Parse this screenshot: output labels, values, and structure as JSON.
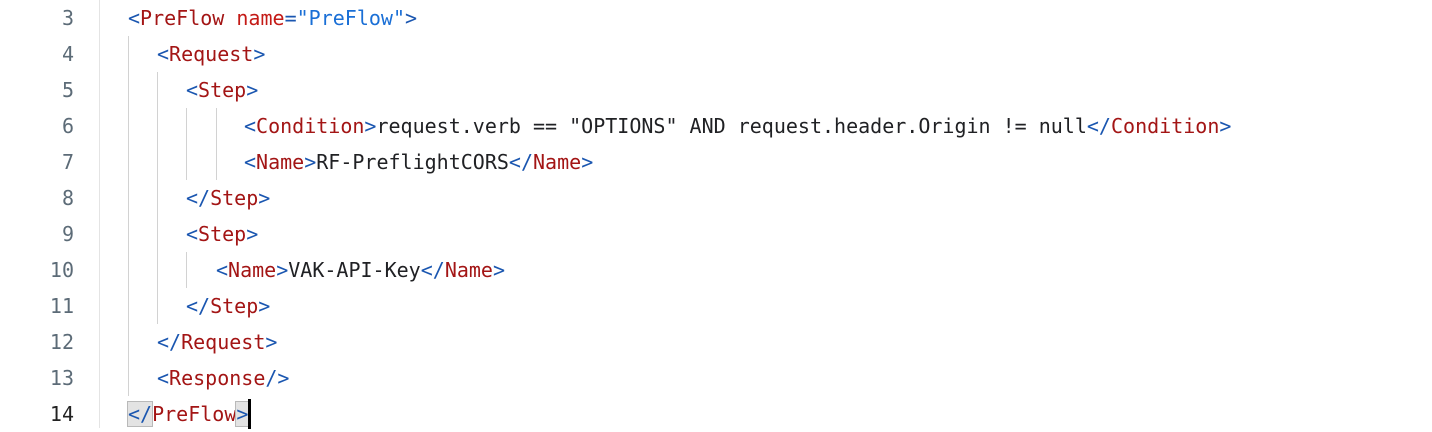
{
  "editor": {
    "lines": [
      {
        "number": "3",
        "tokens": [
          {
            "k": "p",
            "v": "<"
          },
          {
            "k": "t",
            "v": "PreFlow"
          },
          {
            "k": "x",
            "v": " "
          },
          {
            "k": "a",
            "v": "name"
          },
          {
            "k": "p",
            "v": "="
          },
          {
            "k": "s",
            "v": "\"PreFlow\""
          },
          {
            "k": "p",
            "v": ">"
          }
        ]
      },
      {
        "number": "4",
        "tokens": [
          {
            "k": "p",
            "v": "<"
          },
          {
            "k": "t",
            "v": "Request"
          },
          {
            "k": "p",
            "v": ">"
          }
        ]
      },
      {
        "number": "5",
        "tokens": [
          {
            "k": "p",
            "v": "<"
          },
          {
            "k": "t",
            "v": "Step"
          },
          {
            "k": "p",
            "v": ">"
          }
        ]
      },
      {
        "number": "6",
        "tokens": [
          {
            "k": "p",
            "v": "<"
          },
          {
            "k": "t",
            "v": "Condition"
          },
          {
            "k": "p",
            "v": ">"
          },
          {
            "k": "x",
            "v": "request.verb == \"OPTIONS\" AND request.header.Origin != null"
          },
          {
            "k": "p",
            "v": "</"
          },
          {
            "k": "t",
            "v": "Condition"
          },
          {
            "k": "p",
            "v": ">"
          }
        ]
      },
      {
        "number": "7",
        "tokens": [
          {
            "k": "p",
            "v": "<"
          },
          {
            "k": "t",
            "v": "Name"
          },
          {
            "k": "p",
            "v": ">"
          },
          {
            "k": "x",
            "v": "RF-PreflightCORS"
          },
          {
            "k": "p",
            "v": "</"
          },
          {
            "k": "t",
            "v": "Name"
          },
          {
            "k": "p",
            "v": ">"
          }
        ]
      },
      {
        "number": "8",
        "tokens": [
          {
            "k": "p",
            "v": "</"
          },
          {
            "k": "t",
            "v": "Step"
          },
          {
            "k": "p",
            "v": ">"
          }
        ]
      },
      {
        "number": "9",
        "tokens": [
          {
            "k": "p",
            "v": "<"
          },
          {
            "k": "t",
            "v": "Step"
          },
          {
            "k": "p",
            "v": ">"
          }
        ]
      },
      {
        "number": "10",
        "tokens": [
          {
            "k": "p",
            "v": "<"
          },
          {
            "k": "t",
            "v": "Name"
          },
          {
            "k": "p",
            "v": ">"
          },
          {
            "k": "x",
            "v": "VAK-API-Key"
          },
          {
            "k": "p",
            "v": "</"
          },
          {
            "k": "t",
            "v": "Name"
          },
          {
            "k": "p",
            "v": ">"
          }
        ]
      },
      {
        "number": "11",
        "tokens": [
          {
            "k": "p",
            "v": "</"
          },
          {
            "k": "t",
            "v": "Step"
          },
          {
            "k": "p",
            "v": ">"
          }
        ]
      },
      {
        "number": "12",
        "tokens": [
          {
            "k": "p",
            "v": "</"
          },
          {
            "k": "t",
            "v": "Request"
          },
          {
            "k": "p",
            "v": ">"
          }
        ]
      },
      {
        "number": "13",
        "tokens": [
          {
            "k": "p",
            "v": "<"
          },
          {
            "k": "t",
            "v": "Response"
          },
          {
            "k": "p",
            "v": "/>"
          }
        ]
      },
      {
        "number": "14",
        "tokens": [
          {
            "k": "p",
            "v": "</",
            "hl": true
          },
          {
            "k": "t",
            "v": "PreFlow"
          },
          {
            "k": "p",
            "v": ">",
            "hl": true
          }
        ]
      }
    ],
    "active_line_index": 11,
    "colors": {
      "bracket": "#1a56b0",
      "tag": "#a31515",
      "attribute": "#c41a16",
      "string": "#1a6fd6",
      "text": "#202124",
      "gutter_number": "#5c6b77"
    }
  }
}
